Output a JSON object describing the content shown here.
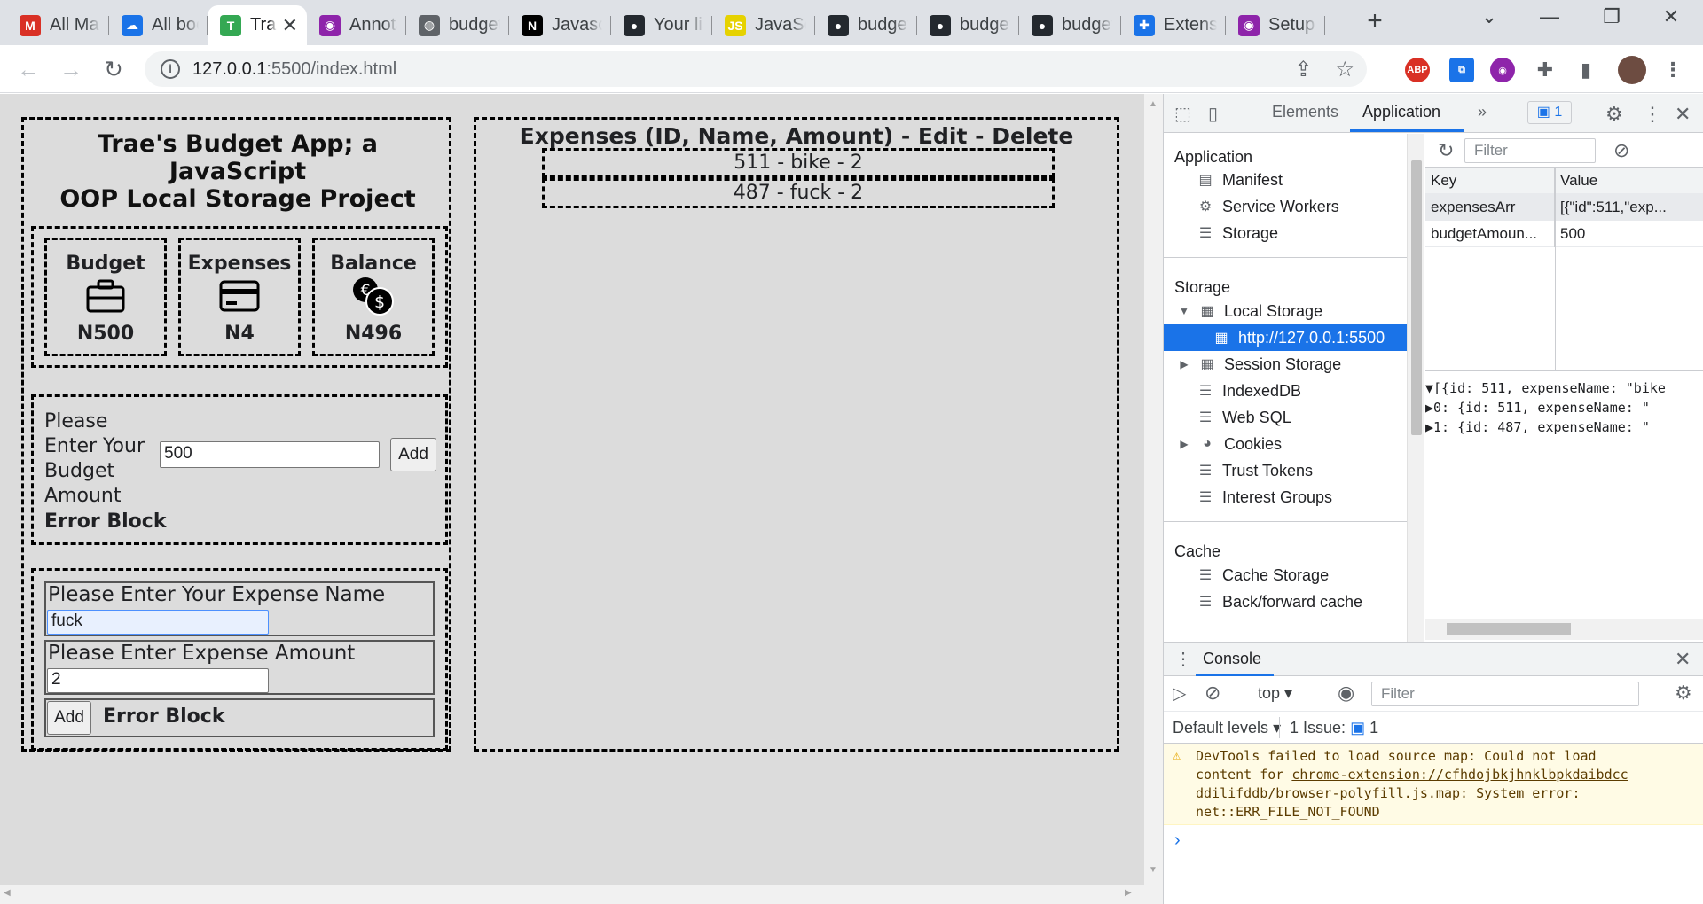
{
  "browser": {
    "tabs": [
      {
        "title": "All Mai",
        "icon": "gmail-icon",
        "color": "#d93025",
        "glyph": "M"
      },
      {
        "title": "All boo",
        "icon": "cloud-icon",
        "color": "#1a73e8",
        "glyph": "☁"
      },
      {
        "title": "Tra",
        "icon": "app-icon",
        "color": "#34a853",
        "glyph": "T",
        "active": true
      },
      {
        "title": "Annota",
        "icon": "annotate-icon",
        "color": "#8e24aa",
        "glyph": "◉"
      },
      {
        "title": "budget",
        "icon": "globe-icon",
        "color": "#5f6368",
        "glyph": "◍"
      },
      {
        "title": "Javascr",
        "icon": "notion-icon",
        "color": "#000000",
        "glyph": "N"
      },
      {
        "title": "Your lis",
        "icon": "github-icon",
        "color": "#24292f",
        "glyph": "●"
      },
      {
        "title": "JavaSc",
        "icon": "js-icon",
        "color": "#e6d200",
        "glyph": "JS"
      },
      {
        "title": "budget",
        "icon": "github-icon",
        "color": "#24292f",
        "glyph": "●"
      },
      {
        "title": "budget",
        "icon": "github-icon",
        "color": "#24292f",
        "glyph": "●"
      },
      {
        "title": "budget",
        "icon": "github-icon",
        "color": "#24292f",
        "glyph": "●"
      },
      {
        "title": "Extensi",
        "icon": "puzzle-icon",
        "color": "#1a73e8",
        "glyph": "✚"
      },
      {
        "title": "Setup",
        "icon": "annotate-icon",
        "color": "#8e24aa",
        "glyph": "◉"
      }
    ],
    "url_host": "127.0.0.1",
    "url_path": ":5500/index.html",
    "ext_abp": "ABP"
  },
  "app": {
    "title_line1": "Trae's Budget App; a JavaScript",
    "title_line2": "OOP Local Storage Project",
    "cards": [
      {
        "label": "Budget",
        "value": "N500",
        "icon": "briefcase-icon"
      },
      {
        "label": "Expenses",
        "value": "N4",
        "icon": "credit-card-icon"
      },
      {
        "label": "Balance",
        "value": "N496",
        "icon": "coins-icon"
      }
    ],
    "budget_prompt": [
      "Please",
      "Enter Your",
      "Budget",
      "Amount"
    ],
    "budget_value": "500",
    "add_label": "Add",
    "error_block": "Error Block",
    "expense_name_label": "Please Enter Your Expense Name",
    "expense_name_value": "fuck",
    "expense_amount_label": "Please Enter Expense Amount",
    "expense_amount_value": "2",
    "expenses_heading": "Expenses (ID, Name, Amount) - Edit - Delete",
    "expenses": [
      "511 - bike - 2",
      "487 - fuck - 2"
    ]
  },
  "devtools": {
    "tabs": [
      "Elements",
      "Application"
    ],
    "issues_badge": "1",
    "sidebar": {
      "application_head": "Application",
      "application_items": [
        "Manifest",
        "Service Workers",
        "Storage"
      ],
      "storage_head": "Storage",
      "local_storage": "Local Storage",
      "local_origin": "http://127.0.0.1:5500",
      "storage_items": [
        "Session Storage",
        "IndexedDB",
        "Web SQL",
        "Cookies",
        "Trust Tokens",
        "Interest Groups"
      ],
      "cache_head": "Cache",
      "cache_items": [
        "Cache Storage",
        "Back/forward cache"
      ]
    },
    "filter_placeholder": "Filter",
    "grid_headers": {
      "key": "Key",
      "value": "Value"
    },
    "rows": [
      {
        "key": "expensesArr",
        "value": "[{\"id\":511,\"exp..."
      },
      {
        "key": "budgetAmoun...",
        "value": "500"
      }
    ],
    "preview": [
      "▼[{id: 511, expenseName: \"bike",
      "  ▶0: {id: 511, expenseName: \"",
      "  ▶1: {id: 487, expenseName: \""
    ],
    "console": {
      "title": "Console",
      "context": "top",
      "filter_placeholder": "Filter",
      "levels": "Default levels",
      "issues_label": "1 Issue:",
      "issues_count": "1",
      "warning_lines": [
        "DevTools failed to load source map: Could not load",
        "content for ",
        "ddilifddb/browser-polyfill.js.map",
        "net::ERR_FILE_NOT_FOUND"
      ],
      "warning_link": "chrome-extension://cfhdojbkjhnklbpkdaibdcc",
      "warning_tail": ": System error:",
      "prompt": "›"
    }
  }
}
